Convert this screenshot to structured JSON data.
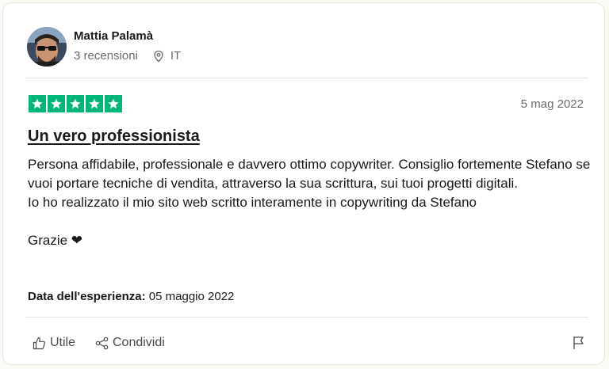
{
  "reviewer": {
    "name": "Mattia Palamà",
    "reviews_count": "3 recensioni",
    "country": "IT"
  },
  "review": {
    "rating": 5,
    "rating_max": 5,
    "star_color": "#00b67a",
    "date": "5 mag 2022",
    "title": "Un vero professionista",
    "paragraphs": [
      "Persona affidabile, professionale e davvero ottimo copywriter. Consiglio fortemente Stefano se vuoi portare tecniche di vendita, attraverso la sua scrittura, sui tuoi progetti digitali.",
      "Io ho realizzato il mio sito web scritto interamente in copywriting da Stefano",
      "Grazie ❤"
    ],
    "experience_label": "Data dell'esperienza:",
    "experience_date": "05 maggio 2022"
  },
  "actions": {
    "useful_label": "Utile",
    "share_label": "Condividi"
  },
  "icons": {
    "location": "map-pin-icon",
    "useful": "thumbs-up-icon",
    "share": "share-icon",
    "report": "flag-icon",
    "star": "star-icon"
  }
}
